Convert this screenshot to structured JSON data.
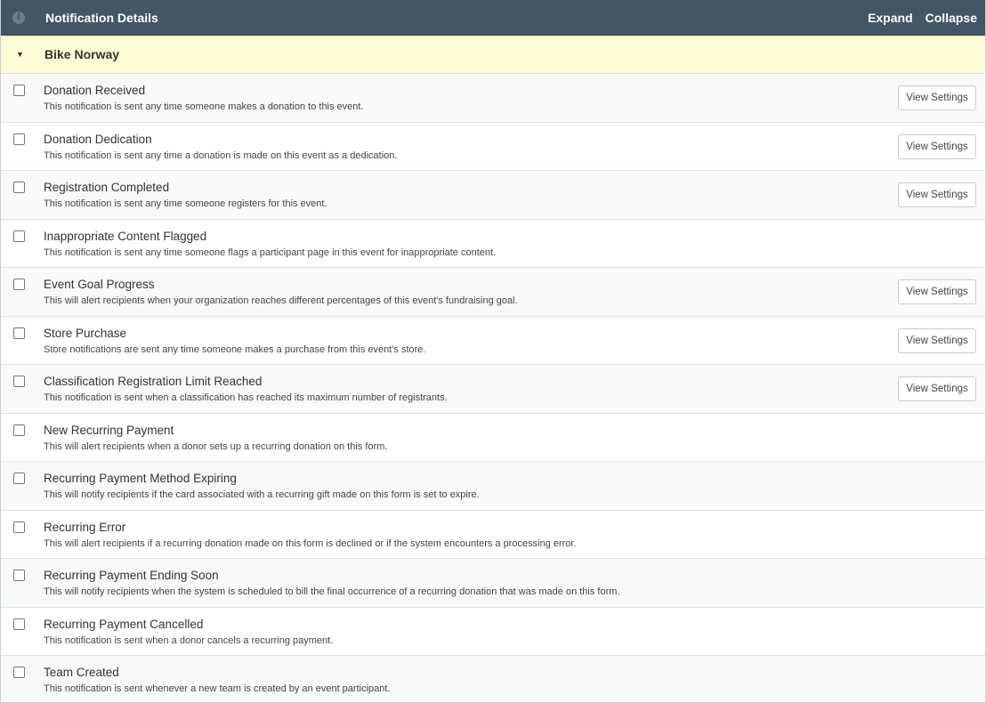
{
  "header": {
    "title": "Notification Details",
    "expand_label": "Expand",
    "collapse_label": "Collapse",
    "info_icon": "i"
  },
  "group": {
    "name": "Bike Norway",
    "caret": "▼"
  },
  "view_settings_label": "View Settings",
  "notifications": [
    {
      "name": "Donation Received",
      "description": "This notification is sent any time someone makes a donation to this event.",
      "has_settings": true
    },
    {
      "name": "Donation Dedication",
      "description": "This notification is sent any time a donation is made on this event as a dedication.",
      "has_settings": true
    },
    {
      "name": "Registration Completed",
      "description": "This notification is sent any time someone registers for this event.",
      "has_settings": true
    },
    {
      "name": "Inappropriate Content Flagged",
      "description": "This notification is sent any time someone flags a participant page in this event for inappropriate content.",
      "has_settings": false
    },
    {
      "name": "Event Goal Progress",
      "description": "This will alert recipients when your organization reaches different percentages of this event's fundraising goal.",
      "has_settings": true
    },
    {
      "name": "Store Purchase",
      "description": "Store notifications are sent any time someone makes a purchase from this event's store.",
      "has_settings": true
    },
    {
      "name": "Classification Registration Limit Reached",
      "description": "This notification is sent when a classification has reached its maximum number of registrants.",
      "has_settings": true
    },
    {
      "name": "New Recurring Payment",
      "description": "This will alert recipients when a donor sets up a recurring donation on this form.",
      "has_settings": false
    },
    {
      "name": "Recurring Payment Method Expiring",
      "description": "This will notify recipients if the card associated with a recurring gift made on this form is set to expire.",
      "has_settings": false
    },
    {
      "name": "Recurring Error",
      "description": "This will alert recipients if a recurring donation made on this form is declined or if the system encounters a processing error.",
      "has_settings": false
    },
    {
      "name": "Recurring Payment Ending Soon",
      "description": "This will notify recipients when the system is scheduled to bill the final occurrence of a recurring donation that was made on this form.",
      "has_settings": false
    },
    {
      "name": "Recurring Payment Cancelled",
      "description": "This notification is sent when a donor cancels a recurring payment.",
      "has_settings": false
    },
    {
      "name": "Team Created",
      "description": "This notification is sent whenever a new team is created by an event participant.",
      "has_settings": false
    }
  ]
}
